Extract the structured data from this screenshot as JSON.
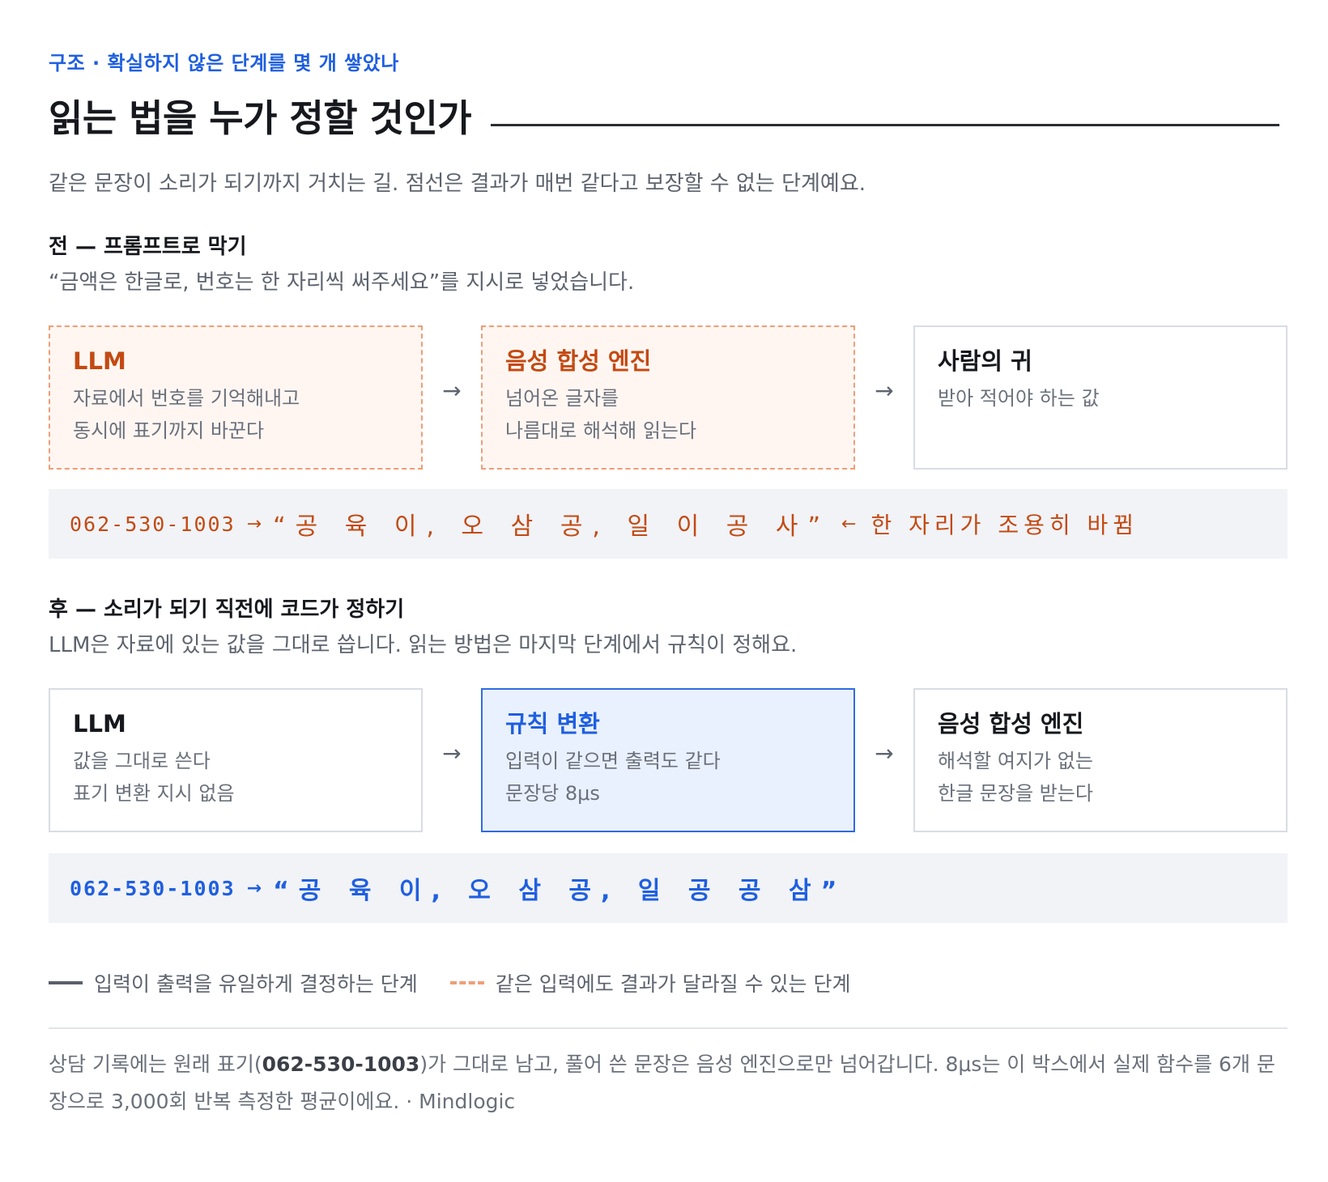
{
  "header": {
    "eyebrow": "구조 · 확실하지 않은 단계를 몇 개 쌓았나",
    "title": "읽는 법을 누가 정할 것인가",
    "subtitle": "같은 문장이 소리가 되기까지 거치는 길. 점선은 결과가 매번 같다고 보장할 수 없는 단계예요."
  },
  "before": {
    "heading": "전 — 프롬프트로 막기",
    "description": "“금액은 한글로, 번호는 한 자리씩 써주세요”를 지시로 넣었습니다.",
    "steps": [
      {
        "title": "LLM",
        "lines": [
          "자료에서 번호를 기억해내고",
          "동시에 표기까지 바꾼다"
        ],
        "style": "dashed"
      },
      {
        "title": "음성 합성 엔진",
        "lines": [
          "넘어온 글자를",
          "나름대로 해석해 읽는다"
        ],
        "style": "dashed"
      },
      {
        "title": "사람의 귀",
        "lines": [
          "받아 적어야 하는 값"
        ],
        "style": "solid"
      }
    ],
    "arrow": "→",
    "example": {
      "number": "062-530-1003",
      "arrow": "→",
      "reading": "“공 육 이, 오 삼 공, 일 이 공 사”",
      "note_arrow": "←",
      "note": "한 자리가 조용히 바뀜"
    }
  },
  "after": {
    "heading": "후 — 소리가 되기 직전에 코드가 정하기",
    "description": "LLM은 자료에 있는 값을 그대로 씁니다. 읽는 방법은 마지막 단계에서 규칙이 정해요.",
    "steps": [
      {
        "title": "LLM",
        "lines": [
          "값을 그대로 쓴다",
          "표기 변환 지시 없음"
        ],
        "style": "solid"
      },
      {
        "title": "규칙 변환",
        "lines": [
          "입력이 같으면 출력도 같다",
          "문장당 8μs"
        ],
        "style": "highlight"
      },
      {
        "title": "음성 합성 엔진",
        "lines": [
          "해석할 여지가 없는",
          "한글 문장을 받는다"
        ],
        "style": "solid"
      }
    ],
    "arrow": "→",
    "example": {
      "number": "062-530-1003",
      "arrow": "→",
      "reading": "“공 육 이, 오 삼 공, 일 공 공 삼”"
    }
  },
  "legend": {
    "deterministic": "입력이 출력을 유일하게 결정하는 단계",
    "nondeterministic": "같은 입력에도 결과가 달라질 수 있는 단계"
  },
  "footer": {
    "before_bold": "상담 기록에는 원래 표기(",
    "bold": "062-530-1003",
    "after_bold": ")가 그대로 남고, 풀어 쓴 문장은 음성 엔진으로만 넘어갑니다. 8μs는 이 박스에서 실제 함수를 6개 문장으로 3,000회 반복 측정한 평균이에요. · Mindlogic"
  },
  "colors": {
    "accent_blue": "#1f5fe0",
    "accent_orange": "#c34a12",
    "dashed_border": "#ef9e78"
  }
}
